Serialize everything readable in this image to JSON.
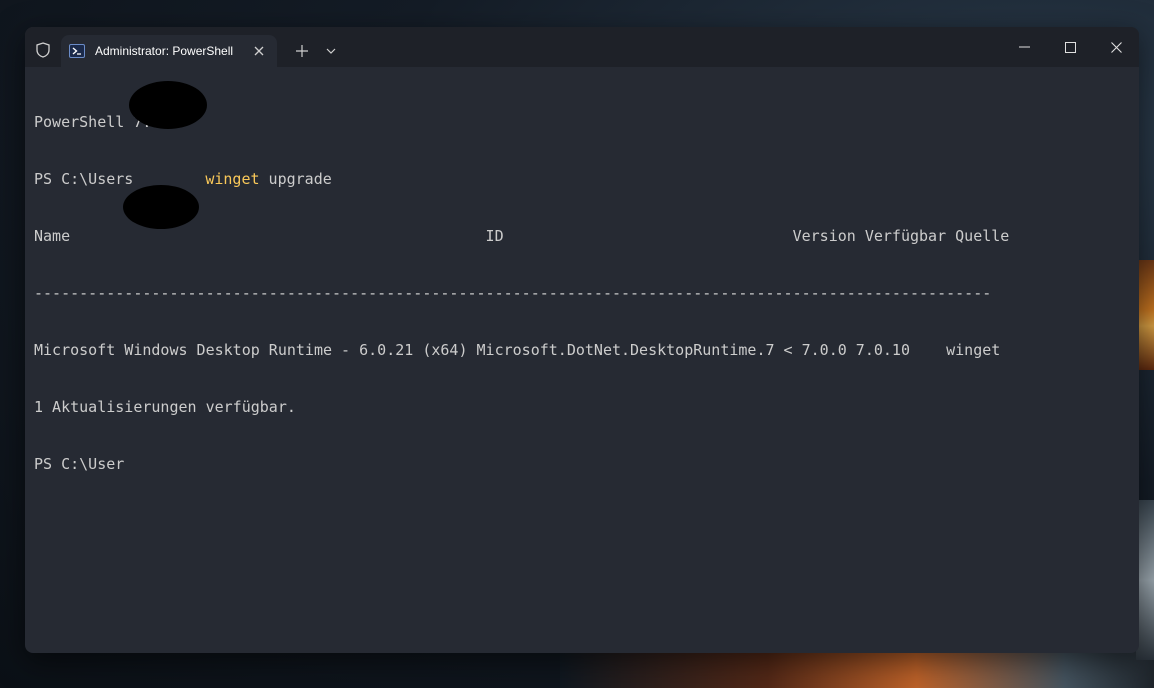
{
  "window": {
    "tab_title": "Administrator: PowerShell",
    "new_tab_label": "+",
    "minimize_label": "─",
    "close_label": "✕"
  },
  "terminal": {
    "banner": "PowerShell 7.3.6",
    "prompt1_prefix": "PS C:\\Users",
    "command_name": "winget",
    "command_args": " upgrade",
    "table_header": "Name                                              ID                                Version Verfügbar Quelle",
    "table_separator": "----------------------------------------------------------------------------------------------------------",
    "table_row": "Microsoft Windows Desktop Runtime - 6.0.21 (x64) Microsoft.DotNet.DesktopRuntime.7 < 7.0.0 7.0.10    winget",
    "summary": "1 Aktualisierungen verfügbar.",
    "prompt2_prefix": "PS C:\\User"
  },
  "icons": {
    "shield": "shield-icon",
    "powershell": "powershell-icon",
    "tab_close": "close-icon",
    "new_tab": "plus-icon",
    "dropdown": "chevron-down-icon",
    "minimize": "minimize-icon",
    "maximize": "maximize-icon",
    "close": "close-icon"
  },
  "colors": {
    "terminal_bg": "#262a33",
    "titlebar_bg": "#1e2128",
    "text": "#cccccc",
    "command": "#f9c859"
  }
}
